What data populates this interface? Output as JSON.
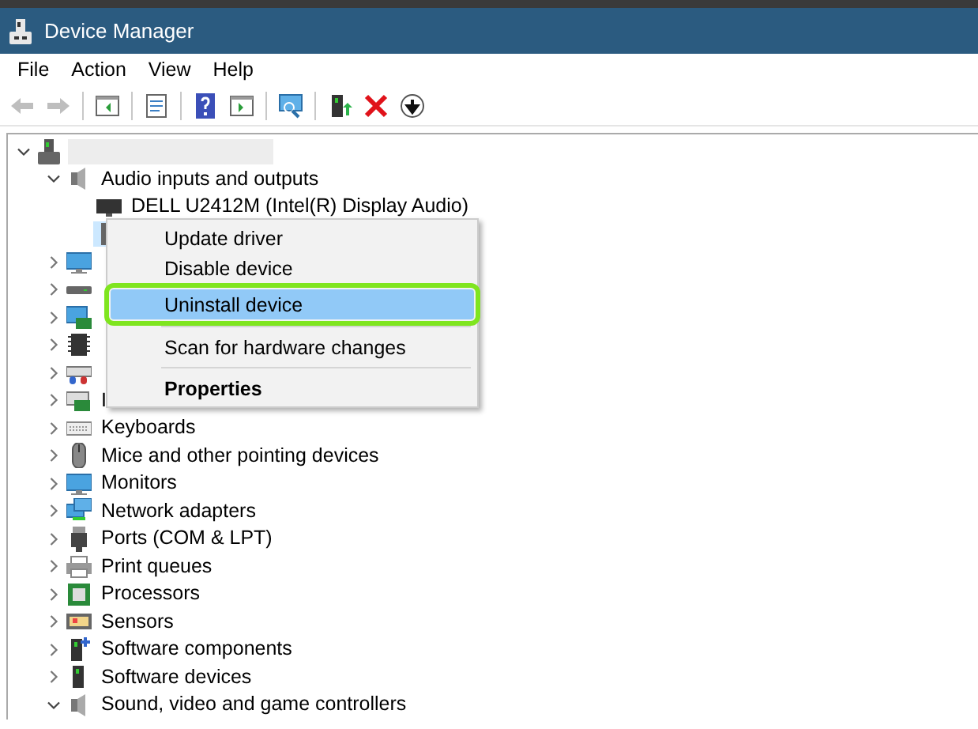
{
  "window": {
    "title": "Device Manager"
  },
  "menu_bar": [
    "File",
    "Action",
    "View",
    "Help"
  ],
  "toolbar": [
    {
      "kind": "back",
      "disabled": true
    },
    {
      "kind": "forward",
      "disabled": true
    },
    {
      "kind": "separator"
    },
    {
      "kind": "panel"
    },
    {
      "kind": "separator"
    },
    {
      "kind": "sheet"
    },
    {
      "kind": "separator"
    },
    {
      "kind": "help"
    },
    {
      "kind": "run"
    },
    {
      "kind": "separator"
    },
    {
      "kind": "scan"
    },
    {
      "kind": "separator"
    },
    {
      "kind": "update"
    },
    {
      "kind": "remove"
    },
    {
      "kind": "download"
    }
  ],
  "tree": [
    {
      "expanded": true,
      "children": [
        {
          "label": "Audio inputs and outputs",
          "expanded": true,
          "selected": false,
          "children": [
            {
              "label": "DELL U2412M (Intel(R) Display Audio)",
              "selected": false
            },
            {
              "selected": true
            }
          ]
        },
        {
          "expanded": false,
          "selected": false
        },
        {
          "expanded": false,
          "selected": false
        },
        {
          "expanded": false,
          "selected": false
        },
        {
          "expanded": false,
          "selected": false
        },
        {
          "expanded": false,
          "selected": false
        },
        {
          "label": "I",
          "expanded": false,
          "selected": false
        },
        {
          "label": "Keyboards",
          "expanded": false,
          "selected": false
        },
        {
          "label": "Mice and other pointing devices",
          "expanded": false,
          "selected": false
        },
        {
          "label": "Monitors",
          "expanded": false,
          "selected": false
        },
        {
          "label": "Network adapters",
          "expanded": false,
          "selected": false
        },
        {
          "label": "Ports (COM & LPT)",
          "expanded": false,
          "selected": false
        },
        {
          "label": "Print queues",
          "expanded": false,
          "selected": false
        },
        {
          "label": "Processors",
          "expanded": false,
          "selected": false
        },
        {
          "label": "Sensors",
          "expanded": false,
          "selected": false
        },
        {
          "label": "Software components",
          "expanded": false,
          "selected": false
        },
        {
          "label": "Software devices",
          "expanded": false,
          "selected": false
        },
        {
          "label": "Sound, video and game controllers",
          "expanded": true,
          "selected": false
        }
      ]
    }
  ],
  "context_menu": [
    {
      "kind": "item",
      "label": "Update driver",
      "selected": false,
      "bold": false
    },
    {
      "kind": "item",
      "label": "Disable device",
      "selected": false,
      "bold": false
    },
    {
      "kind": "item",
      "label": "Uninstall device",
      "selected": true,
      "emphasized": true,
      "bold": false
    },
    {
      "kind": "separator"
    },
    {
      "kind": "item",
      "label": "Scan for hardware changes",
      "selected": false,
      "bold": false
    },
    {
      "kind": "separator"
    },
    {
      "kind": "item",
      "label": "Properties",
      "selected": false,
      "bold": true
    }
  ]
}
